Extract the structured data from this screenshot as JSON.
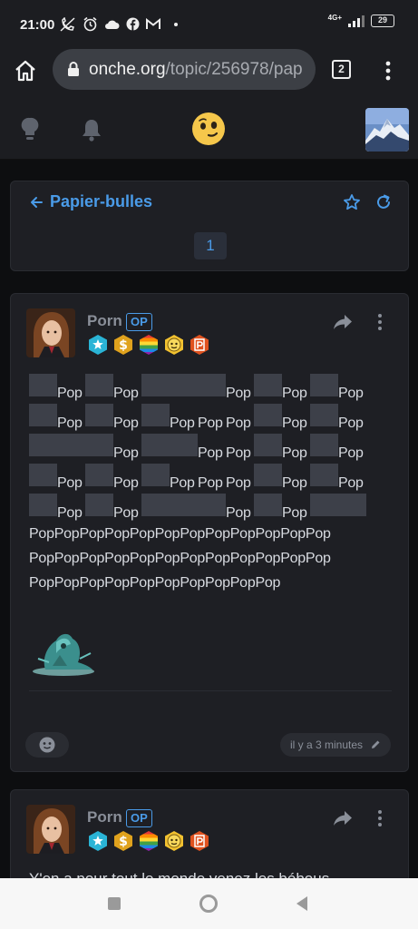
{
  "status_bar": {
    "time": "21:00",
    "network": "4G+",
    "battery": "29"
  },
  "browser": {
    "url_domain": "onche.org",
    "url_path": "/topic/256978/pap",
    "tab_count": "2"
  },
  "topic": {
    "title": "Papier-bulles",
    "page": "1"
  },
  "posts": [
    {
      "author": "Porn",
      "op_label": "OP",
      "body_grid": [
        [
          "blk",
          "Pop",
          "blk",
          "Pop",
          "blk",
          "blk",
          "blk",
          "Pop",
          "blk",
          "Pop",
          "blk",
          "Pop"
        ],
        [
          "blk",
          "Pop",
          "blk",
          "Pop",
          "blk",
          "Pop",
          "Pop",
          "Pop",
          "blk",
          "Pop",
          "blk",
          "Pop"
        ],
        [
          "blk",
          "blk",
          "blk",
          "Pop",
          "blk",
          "blk",
          "Pop",
          "Pop",
          "blk",
          "Pop",
          "blk",
          "Pop"
        ],
        [
          "blk",
          "Pop",
          "blk",
          "Pop",
          "blk",
          "Pop",
          "Pop",
          "Pop",
          "blk",
          "Pop",
          "blk",
          "Pop"
        ],
        [
          "blk",
          "Pop",
          "blk",
          "Pop",
          "blk",
          "blk",
          "blk",
          "Pop",
          "blk",
          "Pop",
          "blk",
          "blk"
        ]
      ],
      "body_lines": [
        "PopPopPopPopPopPopPopPopPopPopPopPop",
        "PopPopPopPopPopPopPopPopPopPopPopPop",
        "PopPopPopPopPopPopPopPopPopPop"
      ],
      "timestamp": "il y a 3 minutes"
    },
    {
      "author": "Porn",
      "op_label": "OP",
      "body_preview": "Y'en a pour tout le monde venez les bébous"
    }
  ],
  "colors": {
    "accent": "#4a9be8",
    "background": "#0d0e10",
    "card": "#1e1f24",
    "blank_cell": "#3d4049"
  },
  "icons": [
    "home-icon",
    "lock-icon",
    "tabs-icon",
    "menu-icon",
    "bulb-icon",
    "bell-icon",
    "logo-smiley-icon",
    "back-arrow-icon",
    "star-icon",
    "refresh-icon",
    "share-icon",
    "more-icon",
    "reaction-icon",
    "edit-icon"
  ]
}
